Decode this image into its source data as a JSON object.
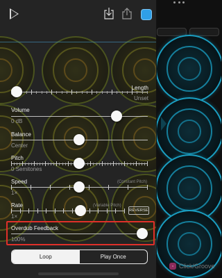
{
  "toolbar": {
    "play_icon": "play-icon",
    "download_icon": "download-icon",
    "share_icon": "share-icon",
    "color_swatch": "#2f9fe8"
  },
  "sliders": {
    "length": {
      "label": "Length",
      "value": "Unset",
      "position": 0.0
    },
    "volume": {
      "label": "Volume",
      "value": "0 dB",
      "position": 0.78
    },
    "balance": {
      "label": "Balance",
      "value": "Center",
      "position": 0.5
    },
    "pitch": {
      "label": "Pitch",
      "value": "0 Semitones",
      "position": 0.5
    },
    "speed": {
      "label": "Speed",
      "value": "1×",
      "note": "(Constant Pitch)",
      "position": 0.5
    },
    "rate": {
      "label": "Rate",
      "value": "1×",
      "note": "(Variable Pitch)",
      "button": "REVERSE",
      "position": 0.5
    },
    "overdub": {
      "label": "Overdub Feedback",
      "value": "100%",
      "position": 1.0
    }
  },
  "playback_mode": {
    "options": [
      "Loop",
      "Play Once"
    ],
    "selected": "Loop"
  },
  "background": {
    "bottom_label": "Click/Groove",
    "accent_color": "#1a9fc2"
  }
}
